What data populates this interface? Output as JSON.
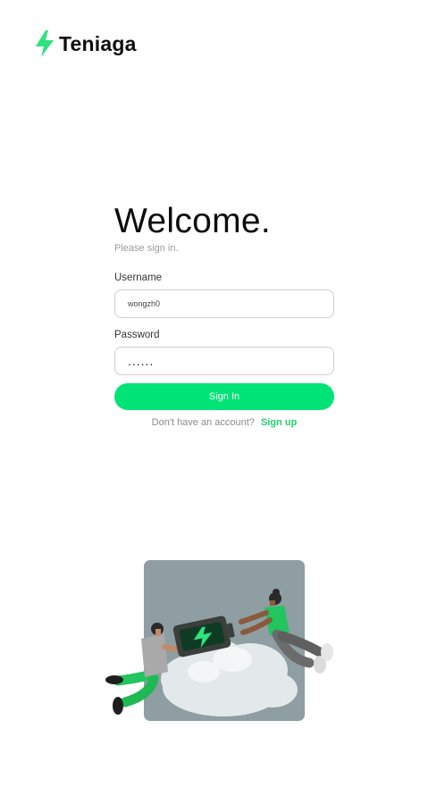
{
  "brand": {
    "name": "Teniaga",
    "icon": "lightning-bolt-icon",
    "accent_color": "#2ee27f"
  },
  "login": {
    "title": "Welcome.",
    "subtitle": "Please sign in.",
    "username_label": "Username",
    "username_value": "wongzh0",
    "password_label": "Password",
    "password_value": "......",
    "signin_label": "Sign In",
    "signup_prompt": "Don't have an account?",
    "signup_link": "Sign up",
    "button_color": "#00e477"
  },
  "illustration": {
    "subject": "two-people-passing-battery-illustration",
    "background_color": "#8e9ea3"
  }
}
